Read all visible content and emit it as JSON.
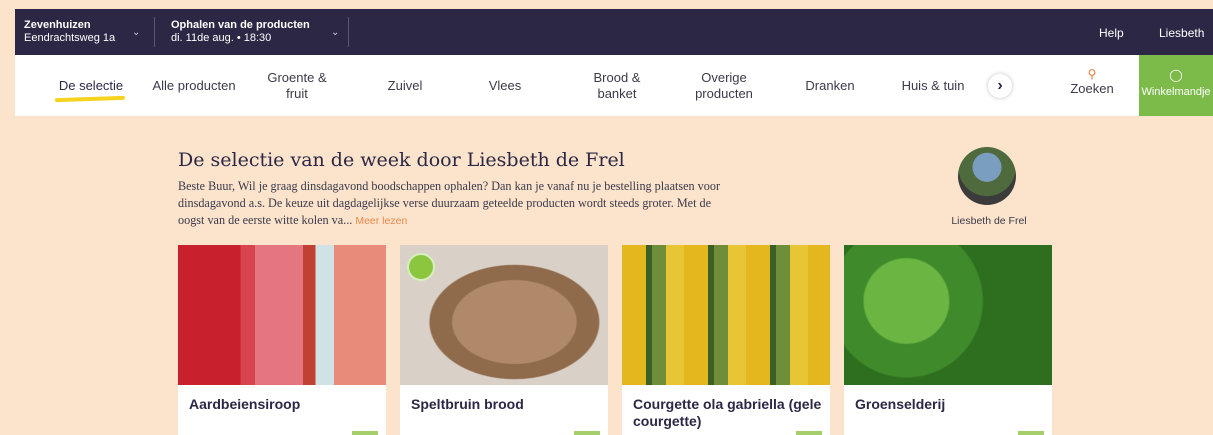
{
  "topbar": {
    "location_title": "Zevenhuizen",
    "location_sub": "Eendrachtsweg 1a",
    "pickup_title": "Ophalen van de producten",
    "pickup_sub": "di. 11de aug. • 18:30",
    "help": "Help",
    "user": "Liesbeth"
  },
  "nav": {
    "items": [
      {
        "label": "De selectie"
      },
      {
        "label": "Alle producten"
      },
      {
        "label": "Groente & fruit"
      },
      {
        "label": "Zuivel"
      },
      {
        "label": "Vlees"
      },
      {
        "label": "Brood & banket"
      },
      {
        "label": "Overige producten"
      },
      {
        "label": "Dranken"
      },
      {
        "label": "Huis & tuin"
      }
    ],
    "search": "Zoeken",
    "cart": "Winkelmandje"
  },
  "selection": {
    "title": "De selectie van de week door Liesbeth de Frel",
    "intro": "Beste Buur, Wil je graag dinsdagavond boodschappen ophalen? Dan kan je vanaf nu je bestelling plaatsen voor dinsdagavond a.s. De keuze uit dagdagelijkse verse duurzaam geteelde producten wordt steeds groter. Met de oogst van de eerste witte kolen va...",
    "more": "Meer lezen",
    "author": "Liesbeth de Frel"
  },
  "products": [
    {
      "name": "Aardbeiensiroop"
    },
    {
      "name": "Speltbruin brood"
    },
    {
      "name": "Courgette ola gabriella (gele courgette)"
    },
    {
      "name": "Groenselderij"
    }
  ],
  "colors": {
    "topbar": "#2b2745",
    "background": "#fbe3cc",
    "accent_yellow": "#f5d31f",
    "cart_green": "#7cba4a",
    "link_orange": "#e8894a"
  }
}
